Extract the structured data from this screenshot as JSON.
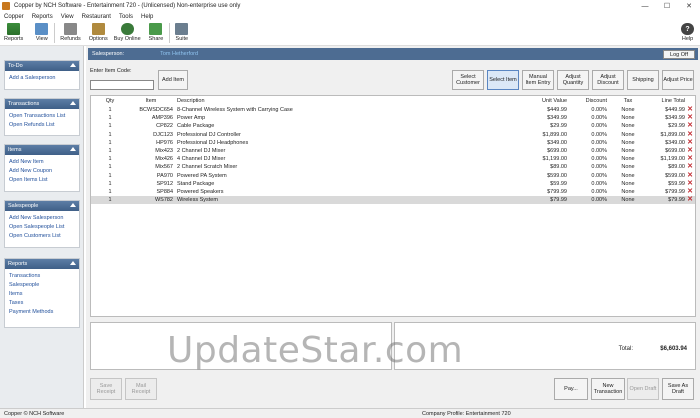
{
  "window": {
    "title": "Copper by NCH Software - Entertainment 720 - (Unlicensed) Non-enterprise use only",
    "controls": {
      "minimize": "—",
      "maximize": "☐",
      "close": "✕"
    }
  },
  "menu": [
    "Copper",
    "Reports",
    "View",
    "Restaurant",
    "Tools",
    "Help"
  ],
  "toolbar": {
    "reports": "Reports",
    "view": "View",
    "refunds": "Refunds",
    "options": "Options",
    "buy_online": "Buy Online",
    "share": "Share",
    "suite": "Suite",
    "help": "Help"
  },
  "sidebar": {
    "todo": {
      "title": "To-Do",
      "items": [
        "Add a Salesperson"
      ]
    },
    "transactions": {
      "title": "Transactions",
      "items": [
        "Open Transactions List",
        "Open Refunds List"
      ]
    },
    "items": {
      "title": "Items",
      "items": [
        "Add New Item",
        "Add New Coupon",
        "Open Items List"
      ]
    },
    "salespeople": {
      "title": "Salespeople",
      "items": [
        "Add New Salesperson",
        "Open Salespeople List",
        "Open Customers List"
      ]
    },
    "reports": {
      "title": "Reports",
      "items": [
        "Transactions",
        "Salespeople",
        "Items",
        "Taxes",
        "Payment Methods"
      ]
    }
  },
  "salesperson_bar": {
    "label": "Salesperson:",
    "name": "Tom Hetherford",
    "logoff": "Log Off"
  },
  "entry": {
    "item_code_label": "Enter Item Code:",
    "item_code_value": "",
    "add_item": "Add Item"
  },
  "actions": {
    "select_customer": "Select Customer",
    "select_item": "Select Item",
    "manual_entry": "Manual Item Entry",
    "adjust_quantity": "Adjust Quantity",
    "adjust_discount": "Adjust Discount",
    "shipping": "Shipping",
    "adjust_price": "Adjust Price"
  },
  "table": {
    "columns": {
      "qty": "Qty",
      "item": "Item",
      "description": "Description",
      "unit_value": "Unit Value",
      "discount": "Discount",
      "tax": "Tax",
      "line_total": "Line Total"
    },
    "delete_glyph": "✕",
    "rows": [
      {
        "qty": "1",
        "item": "BCWSDC654",
        "description": "8-Channel Wireless System with Carrying Case",
        "unit": "$449.99",
        "disc": "0.00%",
        "tax": "None",
        "total": "$449.99"
      },
      {
        "qty": "1",
        "item": "AMP396",
        "description": "Power Amp",
        "unit": "$349.99",
        "disc": "0.00%",
        "tax": "None",
        "total": "$349.99"
      },
      {
        "qty": "1",
        "item": "CP822",
        "description": "Cable Package",
        "unit": "$29.99",
        "disc": "0.00%",
        "tax": "None",
        "total": "$29.99"
      },
      {
        "qty": "1",
        "item": "DJC123",
        "description": "Professional DJ Controller",
        "unit": "$1,899.00",
        "disc": "0.00%",
        "tax": "None",
        "total": "$1,899.00"
      },
      {
        "qty": "1",
        "item": "HP976",
        "description": "Professional DJ Headphones",
        "unit": "$349.00",
        "disc": "0.00%",
        "tax": "None",
        "total": "$349.00"
      },
      {
        "qty": "1",
        "item": "Mix423",
        "description": "2 Channel DJ Mixer",
        "unit": "$699.00",
        "disc": "0.00%",
        "tax": "None",
        "total": "$699.00"
      },
      {
        "qty": "1",
        "item": "Mix426",
        "description": "4 Channel DJ Mixer",
        "unit": "$1,199.00",
        "disc": "0.00%",
        "tax": "None",
        "total": "$1,199.00"
      },
      {
        "qty": "1",
        "item": "Mix567",
        "description": "2 Channel Scratch Mixer",
        "unit": "$89.00",
        "disc": "0.00%",
        "tax": "None",
        "total": "$89.00"
      },
      {
        "qty": "1",
        "item": "PA970",
        "description": "Powered PA System",
        "unit": "$599.00",
        "disc": "0.00%",
        "tax": "None",
        "total": "$599.00"
      },
      {
        "qty": "1",
        "item": "SP912",
        "description": "Stand Package",
        "unit": "$59.99",
        "disc": "0.00%",
        "tax": "None",
        "total": "$59.99"
      },
      {
        "qty": "1",
        "item": "SP884",
        "description": "Powered Speakers",
        "unit": "$799.99",
        "disc": "0.00%",
        "tax": "None",
        "total": "$799.99"
      },
      {
        "qty": "1",
        "item": "WS782",
        "description": "Wireless System",
        "unit": "$79.99",
        "disc": "0.00%",
        "tax": "None",
        "total": "$79.99",
        "selected": true
      }
    ]
  },
  "totals": {
    "label": "Total:",
    "value": "$6,603.94"
  },
  "bottom_buttons": {
    "save_receipt": "Save Receipt",
    "mail_receipt": "Mail Receipt",
    "pay": "Pay...",
    "new_transaction": "New Transaction",
    "open_draft": "Open Draft",
    "save_as_draft": "Save As Draft"
  },
  "status": {
    "left": "Copper © NCH Software",
    "center": "Company Profile: Entertainment 720"
  },
  "watermark": "UpdateStar.com"
}
